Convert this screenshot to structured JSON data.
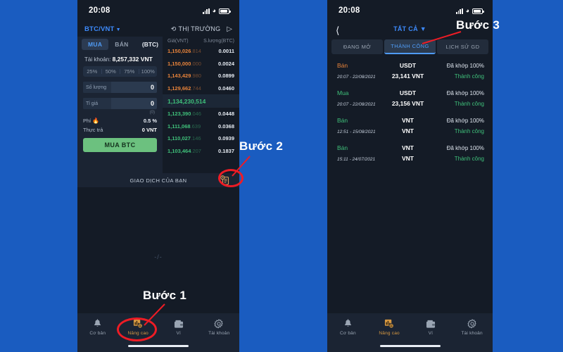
{
  "background_color": "#1a5cc0",
  "annotations": [
    {
      "id": "step1",
      "label": "Bước 1"
    },
    {
      "id": "step2",
      "label": "Bước 2"
    },
    {
      "id": "step3",
      "label": "Bước 3"
    }
  ],
  "left_phone": {
    "statusbar": {
      "time": "20:08",
      "signal_icon": "signal-icon",
      "wifi_icon": "wifi-icon",
      "battery_icon": "battery-icon"
    },
    "topbar": {
      "pair": "BTC/VNT",
      "pair_caret": "▼",
      "market_label": "THỊ TRƯỜNG",
      "refresh_icon": "refresh-icon",
      "send_icon": "send-icon"
    },
    "form": {
      "tab_buy": "MUA",
      "tab_sell": "BÁN",
      "unit_tag": "(BTC)",
      "account_label": "Tài khoản:",
      "account_value": "8,257,332 VNT",
      "percents": [
        "25%",
        "50%",
        "75%",
        "100%"
      ],
      "fields": [
        {
          "label": "Số lượng",
          "value": "0"
        },
        {
          "label": "Tỉ giá",
          "value": "0"
        }
      ],
      "subnote": "(0)",
      "fee_label": "Phí",
      "fee_flame_icon": "flame-icon",
      "fee_value": "0.5 %",
      "paid_label": "Thực trả",
      "paid_value": "0 VNT",
      "submit_label": "MUA BTC"
    },
    "orderbook": {
      "col_price": "Giá(VNT)",
      "col_amount": "S.lượng(BTC)",
      "asks": [
        {
          "main": "1,150,026",
          "dec": ".814",
          "qty": "0.0011"
        },
        {
          "main": "1,150,000",
          "dec": ".000",
          "qty": "0.0024"
        },
        {
          "main": "1,143,429",
          "dec": ".980",
          "qty": "0.0899"
        },
        {
          "main": "1,129,662",
          "dec": ".744",
          "qty": "0.0460"
        }
      ],
      "last_price": "1,134,230,514",
      "bids": [
        {
          "main": "1,123,390",
          "dec": ".046",
          "qty": "0.0448"
        },
        {
          "main": "1,111,068",
          "dec": ".639",
          "qty": "0.0368"
        },
        {
          "main": "1,110,027",
          "dec": ".146",
          "qty": "0.0939"
        },
        {
          "main": "1,103,464",
          "dec": ".207",
          "qty": "0.1837"
        }
      ]
    },
    "my_transactions_bar": {
      "label": "GIAO DỊCH CỦA BẠN",
      "icon": "clipboard-history-icon"
    },
    "chart_placeholder": "-/-",
    "bottom_nav": [
      {
        "label": "Cơ bản",
        "icon": "bell-icon",
        "active": false
      },
      {
        "label": "Nâng cao",
        "icon": "advanced-chart-icon",
        "active": true
      },
      {
        "label": "Ví",
        "icon": "wallet-icon",
        "active": false
      },
      {
        "label": "Tài khoản",
        "icon": "gear-icon",
        "active": false
      }
    ]
  },
  "right_phone": {
    "statusbar": {
      "time": "20:08",
      "signal_icon": "signal-icon",
      "wifi_icon": "wifi-icon",
      "battery_icon": "battery-icon"
    },
    "topbar": {
      "back_icon": "back-chevron-icon",
      "filter_label": "TẤT CẢ",
      "filter_caret": "▼"
    },
    "tabs": [
      {
        "label": "ĐANG MỞ",
        "active": false
      },
      {
        "label": "THÀNH CÔNG",
        "active": true
      },
      {
        "label": "LỊCH SỬ GD",
        "active": false
      }
    ],
    "transactions": [
      {
        "side": "Bán",
        "side_color": "sell",
        "time": "20:07 - 22/08/2021",
        "asset": "USDT",
        "amount": "23,141 VNT",
        "match": "Đã khớp 100%",
        "status": "Thành công"
      },
      {
        "side": "Mua",
        "side_color": "buy",
        "time": "20:07 - 22/08/2021",
        "asset": "USDT",
        "amount": "23,156 VNT",
        "match": "Đã khớp 100%",
        "status": "Thành công"
      },
      {
        "side": "Bán",
        "side_color": "green",
        "time": "12:51 - 15/08/2021",
        "asset": "VNT",
        "amount": "VNT",
        "match": "Đã khớp 100%",
        "status": "Thành công"
      },
      {
        "side": "Bán",
        "side_color": "green",
        "time": "15:11 - 24/07/2021",
        "asset": "VNT",
        "amount": "VNT",
        "match": "Đã khớp 100%",
        "status": "Thành công"
      }
    ],
    "bottom_nav": [
      {
        "label": "Cơ bản",
        "icon": "bell-icon",
        "active": false
      },
      {
        "label": "Nâng cao",
        "icon": "advanced-chart-icon",
        "active": true
      },
      {
        "label": "Ví",
        "icon": "wallet-icon",
        "active": false
      },
      {
        "label": "Tài khoản",
        "icon": "gear-icon",
        "active": false
      }
    ]
  }
}
